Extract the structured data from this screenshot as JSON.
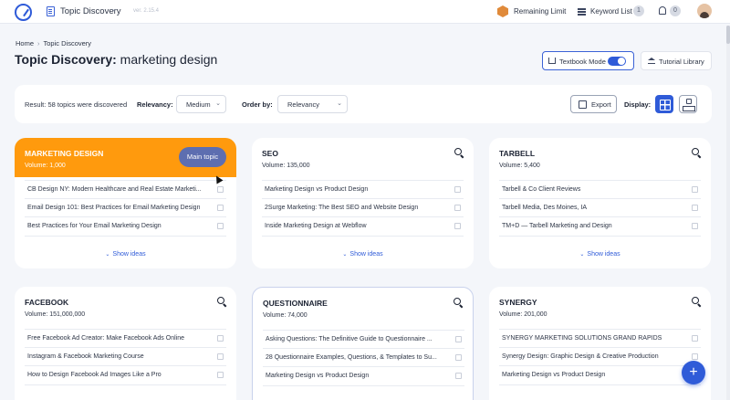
{
  "topbar": {
    "app_title": "Topic Discovery",
    "version": "ver. 2.15.4",
    "remaining_limit": "Remaining Limit",
    "keyword_list": "Keyword List",
    "keyword_count": "1",
    "notification_count": "0"
  },
  "breadcrumb": {
    "home": "Home",
    "current": "Topic Discovery"
  },
  "page": {
    "title_bold": "Topic Discovery:",
    "title_keyword": "marketing design"
  },
  "header_buttons": {
    "textbook_mode": "Textbook Mode",
    "textbook_on": true,
    "tutorial": "Tutorial Library"
  },
  "filters": {
    "result_prefix": "Result:",
    "result_text": "58 topics were discovered",
    "relevancy_label": "Relevancy:",
    "relevancy_value": "Medium",
    "order_label": "Order by:",
    "order_value": "Relevancy",
    "export": "Export",
    "display_label": "Display:"
  },
  "labels": {
    "show_ideas": "Show ideas",
    "main_topic": "Main topic"
  },
  "colors": {
    "accent": "#2f5bd8",
    "main_card": "#ff9a0d"
  },
  "cards": [
    {
      "title": "MARKETING DESIGN",
      "volume": "Volume: 1,000",
      "ideas": [
        "CB Design NY: Modern Healthcare and Real Estate Marketi...",
        "Email Design 101: Best Practices for Email Marketing Design",
        "Best Practices for Your Email Marketing Design"
      ]
    },
    {
      "title": "SEO",
      "volume": "Volume: 135,000",
      "ideas": [
        "Marketing Design vs Product Design",
        "2Surge Marketing: The Best SEO and Website Design",
        "Inside Marketing Design at Webflow"
      ]
    },
    {
      "title": "TARBELL",
      "volume": "Volume: 5,400",
      "ideas": [
        "Tarbell & Co Client Reviews",
        "Tarbell Media, Des Moines, IA",
        "TM+D — Tarbell Marketing and Design"
      ]
    },
    {
      "title": "FACEBOOK",
      "volume": "Volume: 151,000,000",
      "ideas": [
        "Free Facebook Ad Creator: Make Facebook Ads Online",
        "Instagram & Facebook Marketing Course",
        "How to Design Facebook Ad Images Like a Pro"
      ]
    },
    {
      "title": "QUESTIONNAIRE",
      "volume": "Volume: 74,000",
      "ideas": [
        "Asking Questions: The Definitive Guide to Questionnaire ...",
        "28 Questionnaire Examples, Questions, & Templates to Su...",
        "Marketing Design vs Product Design"
      ]
    },
    {
      "title": "SYNERGY",
      "volume": "Volume: 201,000",
      "ideas": [
        "SYNERGY MARKETING SOLUTIONS GRAND RAPIDS",
        "Synergy Design: Graphic Design & Creative Production",
        "Marketing Design vs Product Design"
      ]
    }
  ]
}
